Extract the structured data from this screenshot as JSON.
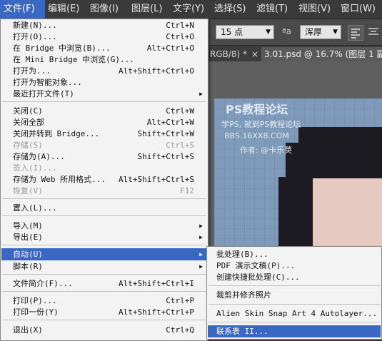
{
  "menubar": {
    "items": [
      {
        "label": "文件(F)"
      },
      {
        "label": "编辑(E)"
      },
      {
        "label": "图像(I)"
      },
      {
        "label": "图层(L)"
      },
      {
        "label": "文字(Y)"
      },
      {
        "label": "选择(S)"
      },
      {
        "label": "滤镜(T)"
      },
      {
        "label": "视图(V)"
      },
      {
        "label": "窗口(W)"
      }
    ]
  },
  "options_bar": {
    "font_size": "15 点",
    "aa_glyph": "ªa",
    "aa_mode": "浑厚"
  },
  "tabs": {
    "prev_tab": "RGB/8) *",
    "close_glyph": "×",
    "active_tab": "3.01.psd @ 16.7% (图层 1 副..."
  },
  "watermark": {
    "title": "PS教程论坛",
    "line2": "学PS, 就到PS教程论坛",
    "line3": "BBS.16XX8.COM",
    "line4": "作者: @卡乐荚"
  },
  "file_menu": {
    "items": [
      {
        "label": "新建(N)...",
        "shortcut": "Ctrl+N",
        "submenu": false,
        "disabled": false,
        "highlighted": false
      },
      {
        "label": "打开(O)...",
        "shortcut": "Ctrl+O",
        "submenu": false,
        "disabled": false,
        "highlighted": false
      },
      {
        "label": "在 Bridge 中浏览(B)...",
        "shortcut": "Alt+Ctrl+O",
        "submenu": false,
        "disabled": false,
        "highlighted": false
      },
      {
        "label": "在 Mini Bridge 中浏览(G)...",
        "shortcut": "",
        "submenu": false,
        "disabled": false,
        "highlighted": false
      },
      {
        "label": "打开为...",
        "shortcut": "Alt+Shift+Ctrl+O",
        "submenu": false,
        "disabled": false,
        "highlighted": false
      },
      {
        "label": "打开为智能对象...",
        "shortcut": "",
        "submenu": false,
        "disabled": false,
        "highlighted": false
      },
      {
        "label": "最近打开文件(T)",
        "shortcut": "",
        "submenu": true,
        "disabled": false,
        "highlighted": false
      },
      {
        "label": "关闭(C)",
        "shortcut": "Ctrl+W",
        "submenu": false,
        "disabled": false,
        "highlighted": false
      },
      {
        "label": "关闭全部",
        "shortcut": "Alt+Ctrl+W",
        "submenu": false,
        "disabled": false,
        "highlighted": false
      },
      {
        "label": "关闭并转到 Bridge...",
        "shortcut": "Shift+Ctrl+W",
        "submenu": false,
        "disabled": false,
        "highlighted": false
      },
      {
        "label": "存储(S)",
        "shortcut": "Ctrl+S",
        "submenu": false,
        "disabled": true,
        "highlighted": false
      },
      {
        "label": "存储为(A)...",
        "shortcut": "Shift+Ctrl+S",
        "submenu": false,
        "disabled": false,
        "highlighted": false
      },
      {
        "label": "签入(I)...",
        "shortcut": "",
        "submenu": false,
        "disabled": true,
        "highlighted": false
      },
      {
        "label": "存储为 Web 所用格式...",
        "shortcut": "Alt+Shift+Ctrl+S",
        "submenu": false,
        "disabled": false,
        "highlighted": false
      },
      {
        "label": "恢复(V)",
        "shortcut": "F12",
        "submenu": false,
        "disabled": true,
        "highlighted": false
      },
      {
        "label": "置入(L)...",
        "shortcut": "",
        "submenu": false,
        "disabled": false,
        "highlighted": false
      },
      {
        "label": "导入(M)",
        "shortcut": "",
        "submenu": true,
        "disabled": false,
        "highlighted": false
      },
      {
        "label": "导出(E)",
        "shortcut": "",
        "submenu": true,
        "disabled": false,
        "highlighted": false
      },
      {
        "label": "自动(U)",
        "shortcut": "",
        "submenu": true,
        "disabled": false,
        "highlighted": true
      },
      {
        "label": "脚本(R)",
        "shortcut": "",
        "submenu": true,
        "disabled": false,
        "highlighted": false
      },
      {
        "label": "文件简介(F)...",
        "shortcut": "Alt+Shift+Ctrl+I",
        "submenu": false,
        "disabled": false,
        "highlighted": false
      },
      {
        "label": "打印(P)...",
        "shortcut": "Ctrl+P",
        "submenu": false,
        "disabled": false,
        "highlighted": false
      },
      {
        "label": "打印一份(Y)",
        "shortcut": "Alt+Shift+Ctrl+P",
        "submenu": false,
        "disabled": false,
        "highlighted": false
      },
      {
        "label": "退出(X)",
        "shortcut": "Ctrl+Q",
        "submenu": false,
        "disabled": false,
        "highlighted": false
      }
    ]
  },
  "automate_submenu": {
    "items": [
      {
        "label": "批处理(B)...",
        "highlighted": false
      },
      {
        "label": "PDF 演示文稿(P)...",
        "highlighted": false
      },
      {
        "label": "创建快捷批处理(C)...",
        "highlighted": false
      },
      {
        "label": "裁剪并修齐照片",
        "highlighted": false
      },
      {
        "label": "Alien Skin Snap Art 4 Autolayer...",
        "highlighted": false
      },
      {
        "label": "联系表 II...",
        "highlighted": true
      }
    ]
  }
}
